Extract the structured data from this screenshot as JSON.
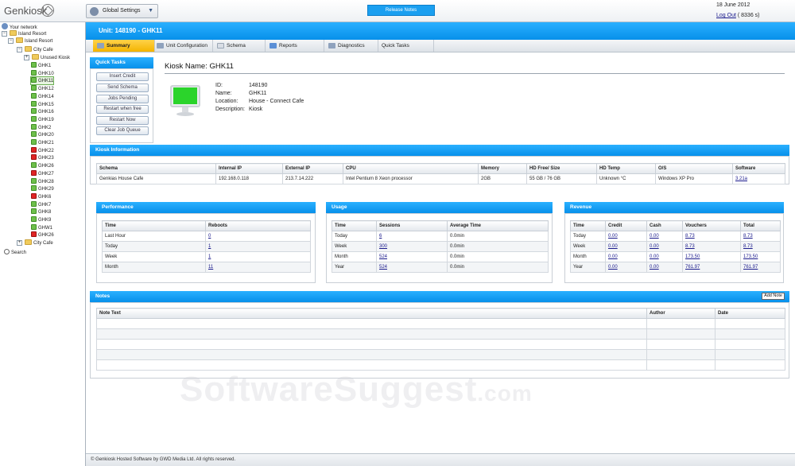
{
  "app": {
    "logo_text": "Genkiosk",
    "global_settings": "Global Settings",
    "release_notes": "Release Notes",
    "date": "18 June 2012",
    "logout": "Log Out",
    "logout_suffix": " ( 8336 s)"
  },
  "sidebar": {
    "your_network": "Your network",
    "island_resort": "Island Resort",
    "island_resort_child": "Island Resort",
    "city_cafe": "City Cafe",
    "unused_kiosk": "Unused Kiosk",
    "kiosks": [
      {
        "label": "GHK1",
        "status": "green"
      },
      {
        "label": "GHK10",
        "status": "green"
      },
      {
        "label": "GHK11",
        "status": "green",
        "selected": true
      },
      {
        "label": "GHK12",
        "status": "green"
      },
      {
        "label": "GHK14",
        "status": "green"
      },
      {
        "label": "GHK15",
        "status": "green"
      },
      {
        "label": "GHK16",
        "status": "green"
      },
      {
        "label": "GHK19",
        "status": "green"
      },
      {
        "label": "GHK2",
        "status": "green"
      },
      {
        "label": "GHK20",
        "status": "green"
      },
      {
        "label": "GHK21",
        "status": "green"
      },
      {
        "label": "GHK22",
        "status": "red"
      },
      {
        "label": "GHK23",
        "status": "red"
      },
      {
        "label": "GHK26",
        "status": "green"
      },
      {
        "label": "GHK27",
        "status": "red"
      },
      {
        "label": "GHK28",
        "status": "green"
      },
      {
        "label": "GHK29",
        "status": "green"
      },
      {
        "label": "GHK6",
        "status": "red"
      },
      {
        "label": "GHK7",
        "status": "green"
      },
      {
        "label": "GHK8",
        "status": "green"
      },
      {
        "label": "GHK9",
        "status": "green"
      },
      {
        "label": "GHW1",
        "status": "green"
      },
      {
        "label": "GHK26",
        "status": "red"
      }
    ],
    "city_cafe_2": "City Cafe",
    "search": "Search"
  },
  "unit": {
    "title": "Unit: 148190 - GHK11"
  },
  "tabs": [
    {
      "label": "Summary",
      "active": true
    },
    {
      "label": "Unit Configuration"
    },
    {
      "label": "Schema"
    },
    {
      "label": "Reports"
    },
    {
      "label": "Diagnostics"
    },
    {
      "label": "Quick Tasks"
    }
  ],
  "quick_tasks": {
    "title": "Quick Tasks",
    "buttons": [
      "Insert Credit",
      "Send Schema",
      "Jobs Pending",
      "Restart when free",
      "Restart Now",
      "Clear Job Queue"
    ]
  },
  "kiosk": {
    "name_label": "Kiosk Name: GHK11",
    "fields": [
      {
        "label": "ID:",
        "value": "148190"
      },
      {
        "label": "Name:",
        "value": "GHK11"
      },
      {
        "label": "Location:",
        "value": "House - Connect Cafe"
      },
      {
        "label": "Description:",
        "value": "Kiosk"
      }
    ]
  },
  "kiosk_info": {
    "title": "Kiosk Information",
    "headers": [
      "Schema",
      "Internal IP",
      "External IP",
      "CPU",
      "Memory",
      "HD Free/ Size",
      "HD Temp",
      "O/S",
      "Software"
    ],
    "row": [
      "Genkias House Cafe",
      "192.168.0.118",
      "213.7.14.222",
      "Intel Pentium 8 Xeon processor",
      "2GB",
      "55 GB / 76 GB",
      "Unknown °C",
      "Windows XP Pro",
      "3.21a"
    ]
  },
  "performance": {
    "title": "Performance",
    "headers": [
      "Time",
      "Reboots"
    ],
    "rows": [
      [
        "Last Hour",
        "0"
      ],
      [
        "Today",
        "1"
      ],
      [
        "Week",
        "1"
      ],
      [
        "Month",
        "11"
      ]
    ]
  },
  "usage": {
    "title": "Usage",
    "headers": [
      "Time",
      "Sessions",
      "Average Time"
    ],
    "rows": [
      [
        "Today",
        "6",
        "0.0min"
      ],
      [
        "Week",
        "300",
        "0.0min"
      ],
      [
        "Month",
        "524",
        "0.0min"
      ],
      [
        "Year",
        "524",
        "0.0min"
      ]
    ]
  },
  "revenue": {
    "title": "Revenue",
    "headers": [
      "Time",
      "Credit",
      "Cash",
      "Vouchers",
      "Total"
    ],
    "rows": [
      [
        "Today",
        "0.00",
        "0.00",
        "8.73",
        "8.73"
      ],
      [
        "Week",
        "0.00",
        "0.00",
        "8.73",
        "8.73"
      ],
      [
        "Month",
        "0.00",
        "0.00",
        "173.50",
        "173.50"
      ],
      [
        "Year",
        "0.00",
        "0.00",
        "761.97",
        "761.97"
      ]
    ]
  },
  "notes": {
    "title": "Notes",
    "add_note": "Add Note",
    "headers": [
      "Note Text",
      "Author",
      "Date"
    ]
  },
  "footer": {
    "text": "© Genkiosk Hosted Software by GWD Media Ltd. All rights reserved."
  },
  "watermark": {
    "main": "SoftwareSuggest",
    "suffix": ".com"
  }
}
